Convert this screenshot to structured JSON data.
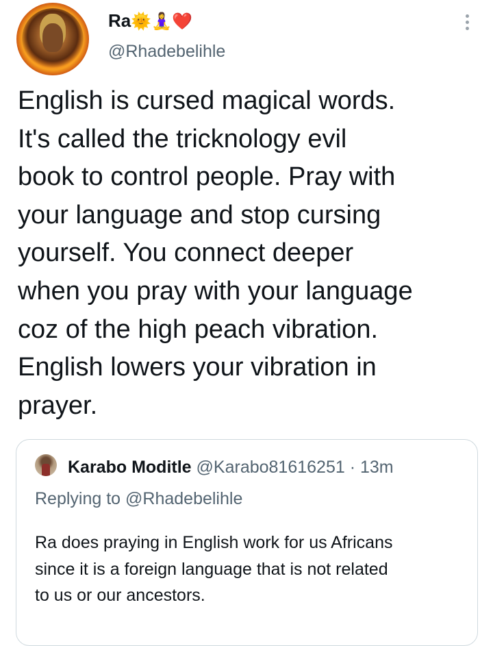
{
  "tweet": {
    "author": {
      "display_name": "Ra",
      "emojis": [
        "🌞",
        "🧘‍♀️",
        "❤️"
      ],
      "handle": "@Rhadebelihle",
      "avatar_icon": "profile-photo"
    },
    "more_icon": "more-vertical-icon",
    "text": "English is cursed magical words.\nIt's called the tricknology evil\nbook to control people. Pray with\nyour language and stop cursing\nyourself. You connect deeper\nwhen you pray with your language\ncoz of the high peach vibration.\nEnglish lowers your vibration in\nprayer."
  },
  "quoted_tweet": {
    "display_name": "Karabo Moditle",
    "handle": "@Karabo81616251",
    "separator": "·",
    "time": "13m",
    "replying_to": "Replying to @Rhadebelihle",
    "text": "Ra does praying in English work for us Africans\nsince it is a foreign language that is not related\nto us or our ancestors."
  },
  "colors": {
    "text_primary": "#0f1419",
    "text_secondary": "#536471",
    "border": "#cfd9de"
  }
}
